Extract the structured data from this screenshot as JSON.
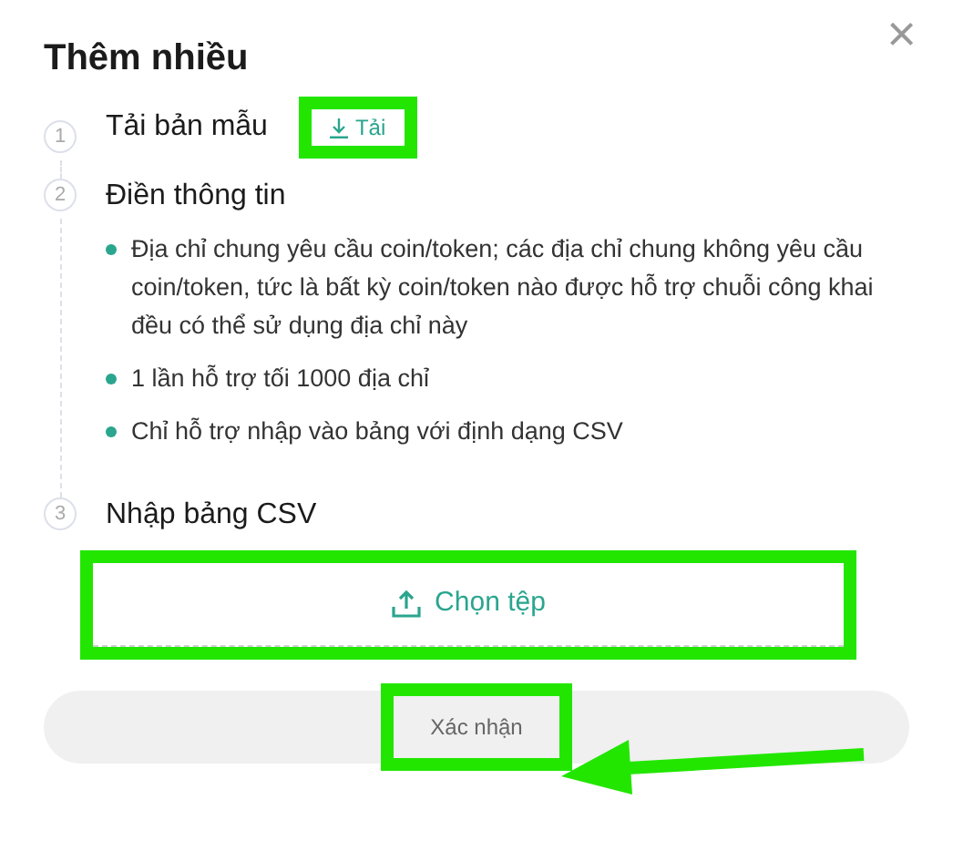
{
  "dialog": {
    "title": "Thêm nhiều",
    "close": "×"
  },
  "steps": [
    {
      "number": "1",
      "label": "Tải bản mẫu",
      "kind": "download",
      "button": {
        "label": "Tải",
        "highlighted": true
      }
    },
    {
      "number": "2",
      "label": "Điền thông tin",
      "kind": "bullets",
      "bullets": [
        "Địa chỉ chung yêu cầu coin/token; các địa chỉ chung không yêu cầu coin/token, tức là bất kỳ coin/token nào được hỗ trợ chuỗi công khai đều có thể sử dụng địa chỉ này",
        "1 lần hỗ trợ tối 1000 địa chỉ",
        "Chỉ hỗ trợ nhập vào bảng với định dạng CSV"
      ]
    },
    {
      "number": "3",
      "label": "Nhập bảng CSV",
      "kind": "upload",
      "button": {
        "label": "Chọn tệp",
        "highlighted": true
      }
    }
  ],
  "confirm": {
    "label": "Xác nhận",
    "highlighted": true,
    "arrow": true
  }
}
